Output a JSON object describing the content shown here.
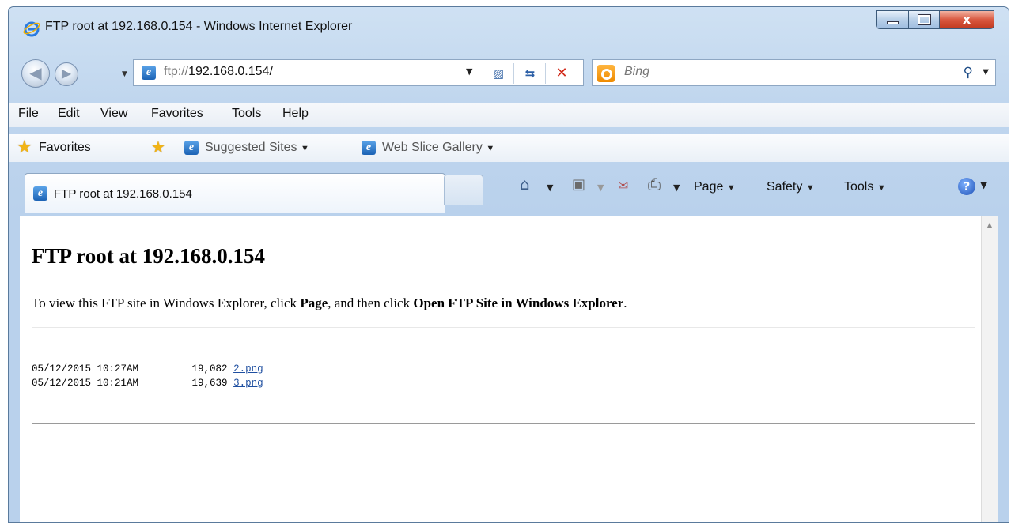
{
  "window": {
    "title": "FTP root at 192.168.0.154 - Windows Internet Explorer",
    "close_glyph": "x"
  },
  "nav": {
    "address_prefix": "ftp://",
    "address_host": "192.168.0.154/",
    "search_placeholder": "Bing"
  },
  "menu": {
    "items": [
      "File",
      "Edit",
      "View",
      "Favorites",
      "Tools",
      "Help"
    ]
  },
  "favorites_bar": {
    "favorites_label": "Favorites",
    "suggested_sites": "Suggested Sites",
    "web_slice_gallery": "Web Slice Gallery"
  },
  "tabs": [
    {
      "label": "FTP root at 192.168.0.154"
    }
  ],
  "command_bar": {
    "page": "Page",
    "safety": "Safety",
    "tools": "Tools"
  },
  "page": {
    "heading": "FTP root at 192.168.0.154",
    "instruction_prefix": "To view this FTP site in Windows Explorer, click ",
    "instruction_page": "Page",
    "instruction_middle": ", and then click ",
    "instruction_action": "Open FTP Site in Windows Explorer",
    "instruction_suffix": ".",
    "files": [
      {
        "date": "05/12/2015 10:27AM",
        "size": "19,082",
        "name": "2.png"
      },
      {
        "date": "05/12/2015 10:21AM",
        "size": "19,639",
        "name": "3.png"
      }
    ]
  },
  "icons": {
    "title": "ie-logo-icon",
    "back": "back-arrow-icon",
    "forward": "forward-arrow-icon",
    "compat": "compatibility-view-icon",
    "refresh": "refresh-icon",
    "stop": "stop-icon",
    "search_provider": "bing-icon",
    "search": "search-icon",
    "home": "home-icon",
    "feeds": "rss-feed-icon",
    "mail": "mail-icon",
    "print": "printer-icon",
    "help": "help-icon"
  },
  "colors": {
    "link": "#1f4fa0",
    "close_button": "#c23a20",
    "frame": "#b9d1ec"
  }
}
